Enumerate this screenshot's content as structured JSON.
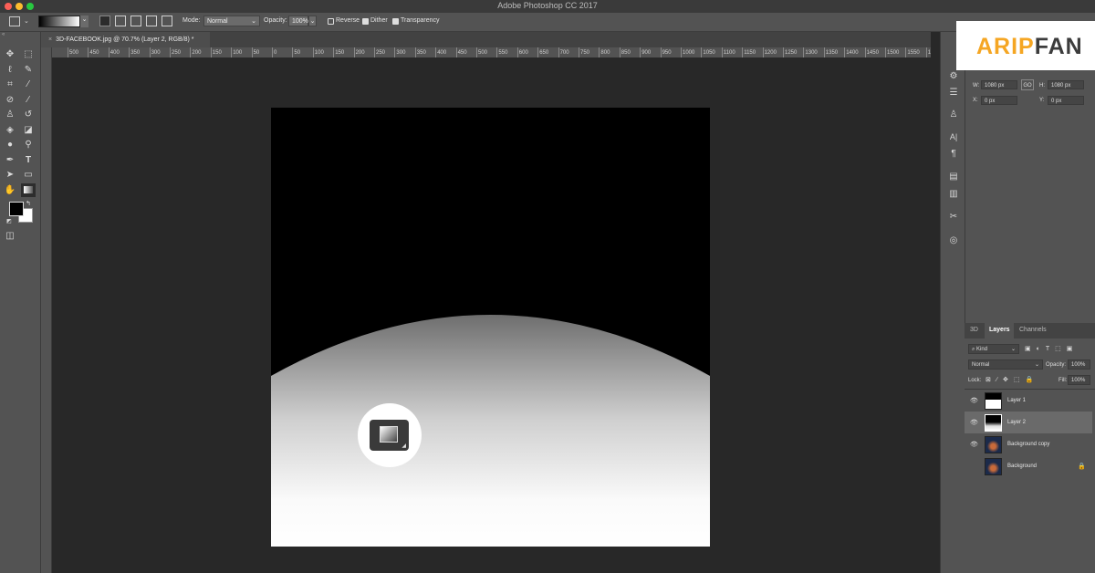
{
  "window": {
    "title": "Adobe Photoshop CC 2017"
  },
  "options": {
    "mode_label": "Mode:",
    "mode_value": "Normal",
    "opacity_label": "Opacity:",
    "opacity_value": "100%",
    "reverse_label": "Reverse",
    "dither_label": "Dither",
    "transparency_label": "Transparency"
  },
  "document": {
    "tab_title": "3D-FACEBOOK.jpg @ 70.7% (Layer 2, RGB/8) *",
    "ruler_ticks": [
      "500",
      "450",
      "400",
      "350",
      "300",
      "250",
      "200",
      "150",
      "100",
      "50",
      "0",
      "50",
      "100",
      "150",
      "200",
      "250",
      "300",
      "350",
      "400",
      "450",
      "500",
      "550",
      "600",
      "650",
      "700",
      "750",
      "800",
      "850",
      "900",
      "950",
      "1000",
      "1050",
      "1100",
      "1150",
      "1200",
      "1250",
      "1300",
      "1350",
      "1400",
      "1450",
      "1500",
      "1550",
      "160"
    ]
  },
  "properties": {
    "w_label": "W:",
    "w_value": "1080 px",
    "h_label": "H:",
    "h_value": "1080 px",
    "x_label": "X:",
    "x_value": "0 px",
    "y_label": "Y:",
    "y_value": "0 px",
    "link_icon": "GO"
  },
  "layers_panel": {
    "tabs": [
      "3D",
      "Layers",
      "Channels"
    ],
    "kind_label": "Kind",
    "blend_mode": "Normal",
    "opacity_label": "Opacity:",
    "opacity_value": "100%",
    "lock_label": "Lock:",
    "fill_label": "Fill:",
    "fill_value": "100%",
    "layers": [
      {
        "name": "Layer 1"
      },
      {
        "name": "Layer 2"
      },
      {
        "name": "Background copy"
      },
      {
        "name": "Background"
      }
    ]
  },
  "logo": {
    "text_orange": "ARIP",
    "text_dark": "FAN"
  },
  "colors": {
    "accent_orange": "#f5a623",
    "logo_dark": "#3c3c3c"
  }
}
